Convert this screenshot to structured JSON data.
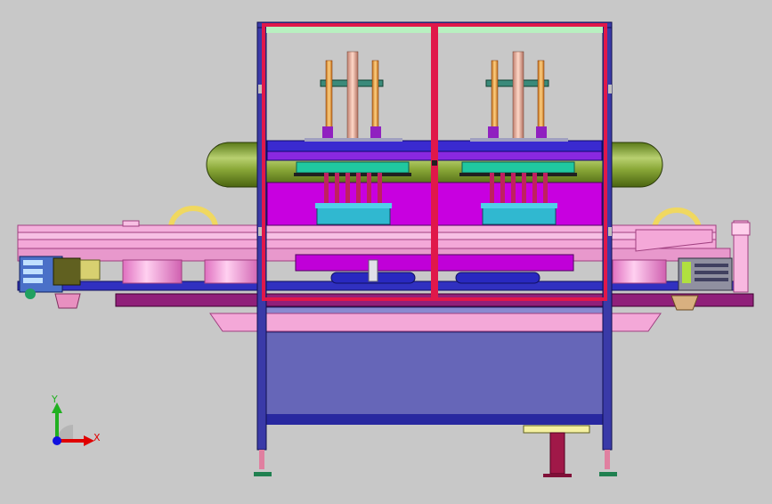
{
  "viewport": {
    "background": "#c8c8c8",
    "description_colors": {
      "frame_blue": "#3a3aa8",
      "frame_red": "#e0184a",
      "tank_green": "#7a9a2a",
      "conveyor_pink": "#f4a8d8",
      "plate_magenta": "#c800e0",
      "cabinet_slate": "#6666b8",
      "rod_orange": "#e89a30",
      "cyan_block": "#30c0d8"
    }
  },
  "triad": {
    "x_label": "X",
    "y_label": "Y",
    "x_color": "#e00000",
    "y_color": "#20b020",
    "origin_color": "#1010e0"
  }
}
